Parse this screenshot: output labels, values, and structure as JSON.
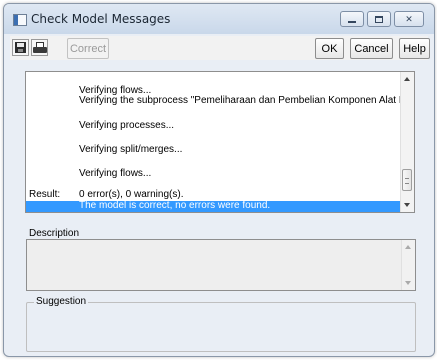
{
  "window": {
    "title": "Check Model Messages"
  },
  "toolbar": {
    "save_icon": "save-icon",
    "print_icon": "print-icon",
    "correct_label": "Correct",
    "ok_label": "OK",
    "cancel_label": "Cancel",
    "help_label": "Help"
  },
  "messages": {
    "lines": [
      "Verifying flows...",
      "Verifying the subprocess \"Pemeliharaan dan Pembelian Komponen Alat HMC\"...",
      "Verifying processes...",
      "Verifying split/merges...",
      "Verifying flows..."
    ],
    "result_label": "Result:",
    "result_value": "0 error(s), 0 warning(s).",
    "selected_message": "The model is correct, no errors were found."
  },
  "description": {
    "label": "Description",
    "text": ""
  },
  "suggestion": {
    "label": "Suggestion",
    "text": ""
  },
  "colors": {
    "selection": "#3399ff",
    "window_bg": "#e9eef5"
  }
}
